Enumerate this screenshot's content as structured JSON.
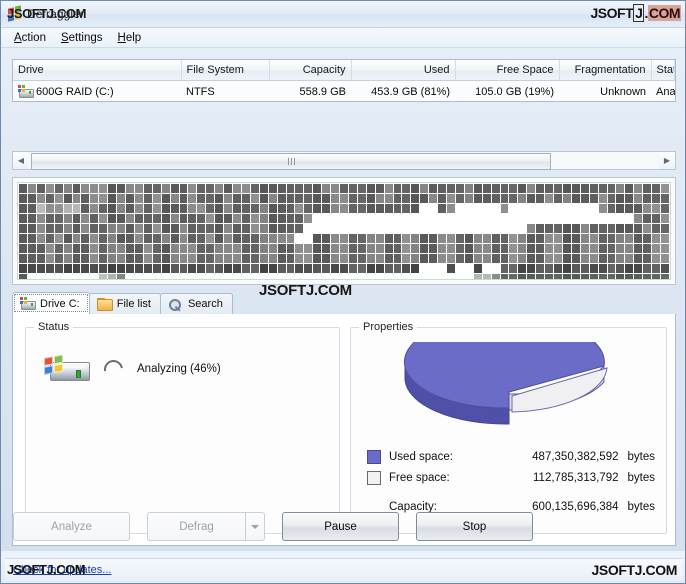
{
  "window": {
    "title": "Defraggler",
    "icon": "piriform-logo-icon"
  },
  "watermarks": {
    "title_overlay": "JSOFTJ.COM",
    "top_right": "JSOFTJ.COM",
    "center": "JSOFTJ.COM",
    "status_left": "JSOFTJ.COM",
    "bottom_right": "JSOFTJ.COM"
  },
  "menubar": {
    "items": [
      {
        "label": "Action",
        "accel": "A"
      },
      {
        "label": "Settings",
        "accel": "S"
      },
      {
        "label": "Help",
        "accel": "H"
      }
    ]
  },
  "drive_table": {
    "columns": [
      {
        "label": "Drive",
        "align": "left"
      },
      {
        "label": "File System",
        "align": "left"
      },
      {
        "label": "Capacity",
        "align": "right"
      },
      {
        "label": "Used",
        "align": "right"
      },
      {
        "label": "Free Space",
        "align": "right"
      },
      {
        "label": "Fragmentation",
        "align": "right"
      },
      {
        "label": "Status",
        "align": "left"
      }
    ],
    "rows": [
      {
        "drive": "600G RAID (C:)",
        "file_system": "NTFS",
        "capacity": "558.9 GB",
        "used": "453.9 GB (81%)",
        "free_space": "105.0 GB (19%)",
        "fragmentation": "Unknown",
        "status": "Analyzing ("
      }
    ]
  },
  "scrollbar": {
    "left_arrow": "◀",
    "right_arrow": "▶"
  },
  "tabs": [
    {
      "label": "Drive C:",
      "icon": "hard-drive-icon",
      "active": true
    },
    {
      "label": "File list",
      "icon": "folder-icon",
      "active": false
    },
    {
      "label": "Search",
      "icon": "magnifier-icon",
      "active": false
    }
  ],
  "status_group": {
    "title": "Status",
    "icon": "hard-drive-icon",
    "spinner": "busy-spinner-icon",
    "text": "Analyzing (46%)",
    "progress_percent": 46
  },
  "properties_group": {
    "title": "Properties",
    "legend": [
      {
        "key": "used",
        "label": "Used space:",
        "value": "487,350,382,592",
        "unit": "bytes",
        "color": "#6b6bc8"
      },
      {
        "key": "free",
        "label": "Free space:",
        "value": "112,785,313,792",
        "unit": "bytes",
        "color": "#f2f2f2"
      }
    ],
    "capacity": {
      "label": "Capacity:",
      "value": "600,135,696,384",
      "unit": "bytes"
    }
  },
  "chart_data": {
    "type": "pie",
    "title": "Properties",
    "labels": [
      "Used space",
      "Free space"
    ],
    "values": [
      487350382592,
      112785313792
    ],
    "percentages": [
      81.2,
      18.8
    ],
    "units": "bytes",
    "colors": [
      "#6b6bc8",
      "#f2f2f2"
    ],
    "total": 600135696384,
    "exploded_slice": "Free space",
    "three_d": true,
    "legend_position": "bottom"
  },
  "buttons": [
    {
      "label": "Analyze",
      "enabled": false,
      "split": false
    },
    {
      "label": "Defrag",
      "enabled": false,
      "split": true
    },
    {
      "label": "Pause",
      "enabled": true,
      "split": false
    },
    {
      "label": "Stop",
      "enabled": true,
      "split": false
    }
  ],
  "statusbar": {
    "link": "Check for updates..."
  },
  "drivemap": {
    "columns": 73,
    "rows": 11,
    "palette": {
      "used_dark": "#4a4a4a",
      "used_mid": "#5e5e5e",
      "used_light": "#8a8a8a",
      "pale": "#b9b9b9",
      "free": "#ffffff"
    },
    "grid": [
      "4545454555445544544544545544444444554444454445444454444445444444444545445",
      "4454545455454545454544454454544444455444554444545454444454454544454445444",
      "4415511454454545444554454445444544455444444440045000005000000000054444554",
      "4454454545445444454445445455444450000000000000000000000000000000000005445",
      "4454454544554545445444454455444400000000000000000000000005444445444444544",
      "4454545454544544545445454445555004455445544554455445544554455445544554455",
      "4445454454554454455544555445544554455445544554455445544554455445544554455",
      "4445454454554454455544555445544554455445544554455445544554455445544554455",
      "3333333333333333344334433443344334433443344330003003004433443344334433443",
      "4000000001150000000000000000000000000000000000000001154444444444444444444",
      "4445454454554454455544555445544554455445544554455445544554455445544554455"
    ]
  }
}
